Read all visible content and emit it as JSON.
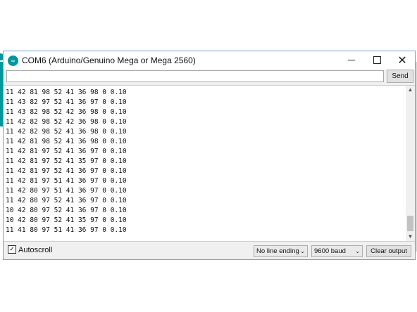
{
  "window": {
    "title": "COM6 (Arduino/Genuino Mega or Mega 2560)"
  },
  "icons": {
    "app": "arduino-icon",
    "minimize": "minimize-icon",
    "maximize": "maximize-icon",
    "close": "close-icon"
  },
  "input": {
    "value": "",
    "placeholder": ""
  },
  "send_label": "Send",
  "output_lines": [
    "11 42 81 98 52 41 36 98 0 0.10",
    "11 43 82 97 52 41 36 97 0 0.10",
    "11 43 82 98 52 42 36 98 0 0.10",
    "11 42 82 98 52 42 36 98 0 0.10",
    "11 42 82 98 52 41 36 98 0 0.10",
    "11 42 81 98 52 41 36 98 0 0.10",
    "11 42 81 97 52 41 36 97 0 0.10",
    "11 42 81 97 52 41 35 97 0 0.10",
    "11 42 81 97 52 41 36 97 0 0.10",
    "11 42 81 97 51 41 36 97 0 0.10",
    "11 42 80 97 51 41 36 97 0 0.10",
    "11 42 80 97 52 41 36 97 0 0.10",
    "10 42 80 97 52 41 36 97 0 0.10",
    "10 42 80 97 52 41 35 97 0 0.10",
    "11 41 80 97 51 41 36 97 0 0.10"
  ],
  "bottom": {
    "autoscroll_label": "Autoscroll",
    "autoscroll_checked": true,
    "line_ending": "No line ending",
    "baud": "9600 baud",
    "clear_label": "Clear output"
  },
  "colors": {
    "arduino_teal": "#00979c",
    "window_border": "#6f9fd6"
  }
}
